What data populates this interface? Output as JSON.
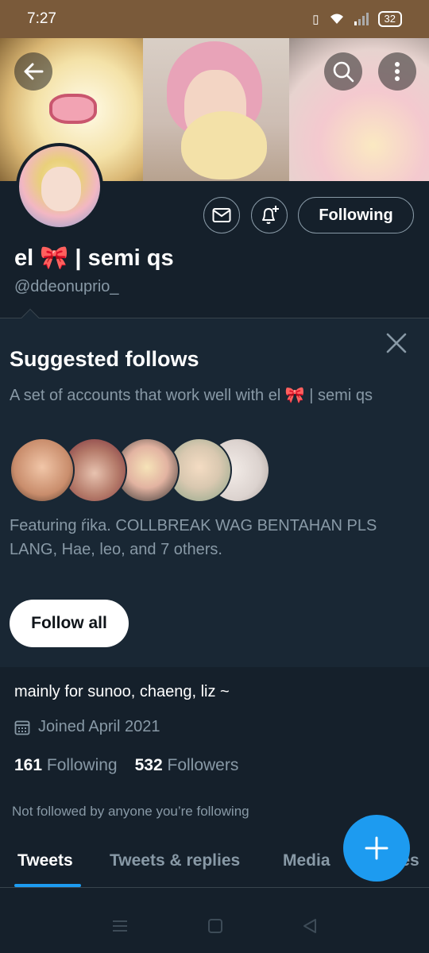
{
  "status_bar": {
    "time": "7:27",
    "battery": "32"
  },
  "profile": {
    "display_name": "el 🎀 | semi qs",
    "handle": "@ddeonuprio_",
    "following_button": "Following",
    "bio": "mainly for sunoo, chaeng, liz ~",
    "joined": "Joined April 2021",
    "following_count": "161",
    "following_label": "Following",
    "followers_count": "532",
    "followers_label": "Followers",
    "not_followed": "Not followed by anyone you’re following"
  },
  "suggested": {
    "title": "Suggested follows",
    "description": "A set of accounts that work well with el 🎀 | semi qs",
    "featuring": "Featuring ŕika. COLLBREAK WAG BENTAHAN PLS LANG, Hae, leo, and 7 others.",
    "follow_all": "Follow all"
  },
  "tabs": [
    {
      "label": "Tweets",
      "active": true
    },
    {
      "label": "Tweets & replies",
      "active": false
    },
    {
      "label": "Media",
      "active": false
    },
    {
      "label": "Likes",
      "active": false
    }
  ],
  "colors": {
    "accent": "#1d9bf0",
    "background": "#15202b",
    "panel": "#192734",
    "secondary_text": "#8899a6"
  }
}
